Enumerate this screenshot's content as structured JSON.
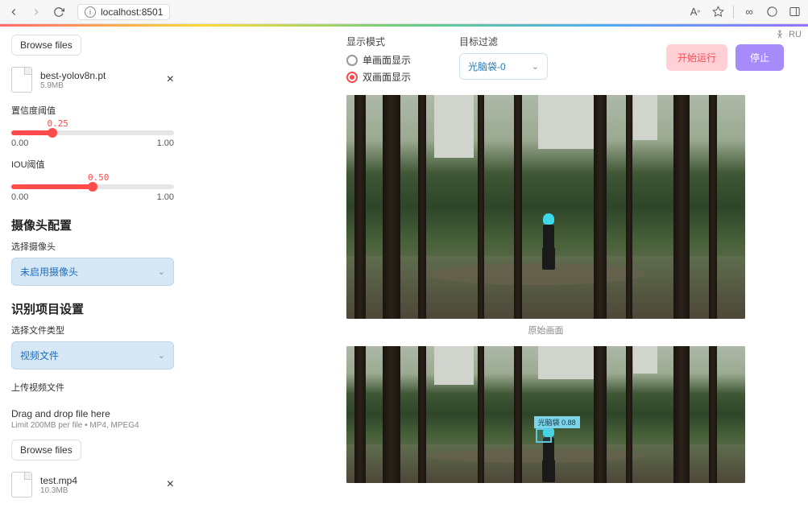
{
  "browser": {
    "url": "localhost:8501",
    "font_indicator": "A",
    "running_label": "RU"
  },
  "sidebar": {
    "browse_label": "Browse files",
    "file1": {
      "name": "best-yolov8n.pt",
      "size": "5.9MB"
    },
    "conf_label": "置信度阈值",
    "conf_value": "0.25",
    "conf_min": "0.00",
    "conf_max": "1.00",
    "conf_pct": 25,
    "iou_label": "IOU阈值",
    "iou_value": "0.50",
    "iou_min": "0.00",
    "iou_max": "1.00",
    "iou_pct": 50,
    "camera_title": "摄像头配置",
    "camera_select_label": "选择摄像头",
    "camera_value": "未启用摄像头",
    "project_title": "识别项目设置",
    "type_label": "选择文件类型",
    "type_value": "视频文件",
    "upload_label": "上传视频文件",
    "dropzone_title": "Drag and drop file here",
    "dropzone_sub": "Limit 200MB per file • MP4, MPEG4",
    "browse2_label": "Browse files",
    "file2": {
      "name": "test.mp4",
      "size": "10.3MB"
    }
  },
  "main": {
    "display_mode_label": "显示模式",
    "radio_single": "单画面显示",
    "radio_dual": "双画面显示",
    "target_filter_label": "目标过滤",
    "target_value": "光脑袋-0",
    "btn_start": "开始运行",
    "btn_stop": "停止",
    "caption1": "原始画面",
    "det_label": "光脑袋 0.88"
  }
}
